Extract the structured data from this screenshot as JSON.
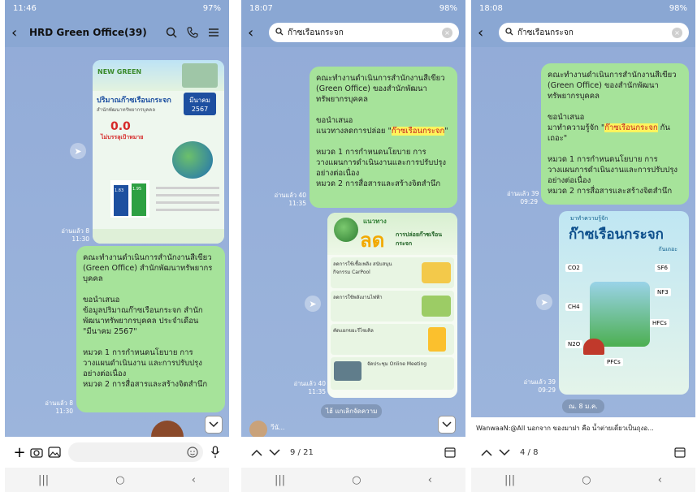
{
  "phones": [
    {
      "status_time": "11:46",
      "status_right": "97%",
      "chat_title": "HRD Green Office(39)",
      "infographic": {
        "header": "NEW GREEN",
        "title": "ปริมาณก๊าซเรือนกระจก",
        "subtitle": "สำนักพัฒนาทรัพยากรบุคคล",
        "month": "มีนาคม 2567",
        "value": "0.0",
        "status": "ไม่บรรลุเป้าหมาย",
        "bar1": "1.83",
        "bar2": "1.95"
      },
      "time1": "อ่านแล้ว 8\n11:30",
      "message": "คณะทำงานดำเนินการสำนักงานสีเขียว (Green Office) สำนักพัฒนาทรัพยากรบุคคล\n\nขอนำเสนอ\nข้อมูลปริมาณก๊าซเรือนกระจก สำนักพัฒนาทรัพยากรบุคคล ประจำเดือน \"มีนาคม 2567\"\n\nหมวด 1 การกำหนดนโยบาย การวางแผนดำเนินงาน และการปรับปรุงอย่างต่อเนื่อง\nหมวด 2 การสื่อสารและสร้างจิตสำนึก",
      "time2": "อ่านแล้ว 8\n11:30"
    },
    {
      "status_time": "18:07",
      "status_right": "98%",
      "search_value": "ก๊าซเรือนกระจก",
      "message_pre": "คณะทำงานดำเนินการสำนักงานสีเขียว (Green Office) ของสำนักพัฒนาทรัพยากรบุคคล\n\nขอนำเสนอ\nแนวทางลดการปล่อย \"",
      "message_hl": "ก๊าซเรือนกระจก",
      "message_post": "\"\n\nหมวด 1 การกำหนดนโยบาย การวางแผนการดำเนินงานและการปรับปรุงอย่างต่อเนื่อง\nหมวด 2 การสื่อสารและสร้างจิตสำนึก",
      "time1": "อ่านแล้ว 40\n11:35",
      "infographic": {
        "title1": "แนวทาง",
        "title2": "ลด",
        "title3": "การปล่อยก๊าซเรือนกระจก",
        "item1": "ลดการใช้เชื้อเพลิง สนับสนุนกิจกรรม CarPool",
        "item2": "ลดการใช้พลังงานไฟฟ้า",
        "item3": "คัดแยกขยะรีไซเคิล",
        "item4": "จัดประชุม Online Meeting"
      },
      "time2": "อ่านแล้ว 40\n11:35",
      "reaction_label": "ไฮ้ แกเลิกจัดความ",
      "sender_name": "วีนั...",
      "pager": "9 / 21"
    },
    {
      "status_time": "18:08",
      "status_right": "98%",
      "search_value": "ก๊าซเรือนกระจก",
      "message_pre": "คณะทำงานดำเนินการสำนักงานสีเขียว (Green Office) ของสำนักพัฒนาทรัพยากรบุคคล\n\nขอนำเสนอ\nมาทำความรู้จัก \"",
      "message_hl": "ก๊าซเรือนกระจก",
      "message_post": " กันเถอะ\"\n\nหมวด 1 การกำหนดนโยบาย การวางแผนการดำเนินงานและการปรับปรุงอย่างต่อเนื่อง\nหมวด 2 การสื่อสารและสร้างจิตสำนึก",
      "time1": "อ่านแล้ว 39\n09:29",
      "infographic": {
        "title1": "มาทำความรู้จัก",
        "title2": "ก๊าซเรือนกระจก",
        "title3": "กันเถอะ",
        "gases": [
          "CO2",
          "SF6",
          "NF3",
          "CH4",
          "HFCs",
          "N2O",
          "PFCs"
        ]
      },
      "time2": "อ่านแล้ว 39\n09:29",
      "date_chip": "ณ. 8 ม.ค.",
      "announcement": "WanwaaN:@All นอกจาก ของมาฝา คือ น้ำต่ายเดี่ยวเป็นถุงอ...",
      "pager": "4 / 8"
    }
  ]
}
